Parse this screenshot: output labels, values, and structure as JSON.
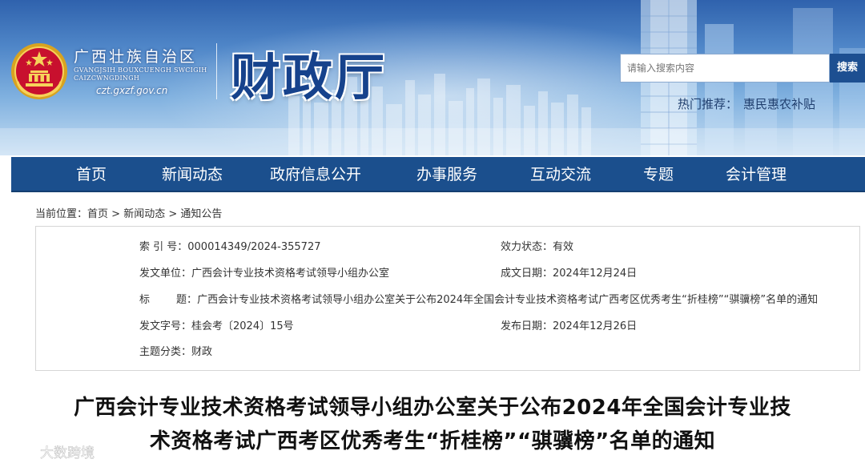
{
  "header": {
    "region_name": "广西壮族自治区",
    "region_sub_line1": "GVANGJSIH BOUXCUENGH SWCIGIH",
    "region_sub_line2": "CAIZCWNGDINGH",
    "region_url": "czt.gxzf.gov.cn",
    "dept_title": "财政厅",
    "search_placeholder": "请输入搜索内容",
    "search_button": "搜索",
    "hot_label": "热门推荐：",
    "hot_link": "惠民惠农补贴"
  },
  "nav": {
    "items": [
      {
        "label": "首页"
      },
      {
        "label": "新闻动态"
      },
      {
        "label": "政府信息公开"
      },
      {
        "label": "办事服务"
      },
      {
        "label": "互动交流"
      },
      {
        "label": "专题"
      },
      {
        "label": "会计管理"
      }
    ]
  },
  "breadcrumb": {
    "prefix": "当前位置：",
    "items": [
      "首页",
      "新闻动态",
      "通知公告"
    ],
    "separator": " > "
  },
  "meta": {
    "index_label": "索  引  号：",
    "index_value": "000014349/2024-355727",
    "status_label": "效力状态：",
    "status_value": "有效",
    "issuer_label": "发文单位：",
    "issuer_value": "广西会计专业技术资格考试领导小组办公室",
    "created_label": "成文日期：",
    "created_value": "2024年12月24日",
    "title_label": "标        题：",
    "title_value": "广西会计专业技术资格考试领导小组办公室关于公布2024年全国会计专业技术资格考试广西考区优秀考生“折桂榜”“骐骥榜”名单的通知",
    "docnum_label": "发文字号：",
    "docnum_value": "桂会考〔2024〕15号",
    "published_label": "发布日期：",
    "published_value": "2024年12月26日",
    "topic_label": "主题分类：",
    "topic_value": "财政"
  },
  "article": {
    "title_line1": "广西会计专业技术资格考试领导小组办公室关于公布2024年全国会计专业技",
    "title_line2": "术资格考试广西考区优秀考生“折桂榜”“骐骥榜”名单的通知"
  },
  "watermark": {
    "text": "大数跨境"
  },
  "colors": {
    "nav_bg": "#1b4f8d",
    "title_blue": "#16428c",
    "search_button_bg": "#1d4f91"
  }
}
